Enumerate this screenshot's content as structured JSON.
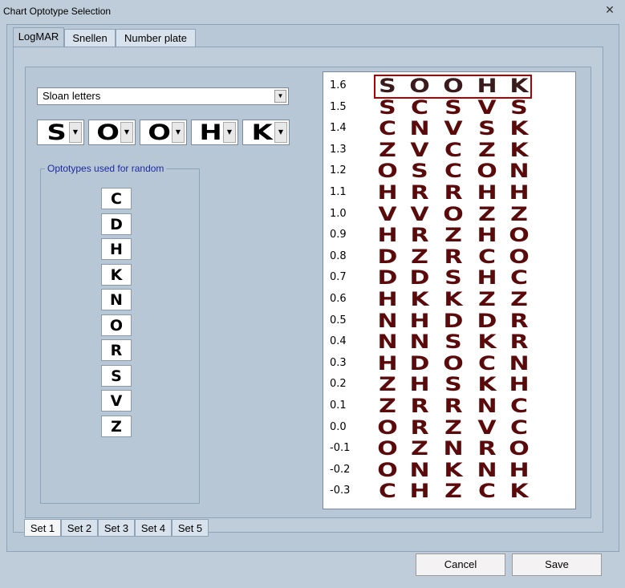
{
  "window": {
    "title": "Chart Optotype Selection",
    "close_symbol": "✕"
  },
  "tabs": [
    "LogMAR",
    "Snellen",
    "Number plate"
  ],
  "font_select": {
    "value": "Sloan letters"
  },
  "optotype_slots": [
    "S",
    "O",
    "O",
    "H",
    "K"
  ],
  "random_group": {
    "label": "Optotypes used for random",
    "letters": [
      "C",
      "D",
      "H",
      "K",
      "N",
      "O",
      "R",
      "S",
      "V",
      "Z"
    ]
  },
  "sets": [
    "Set 1",
    "Set 2",
    "Set 3",
    "Set 4",
    "Set 5"
  ],
  "chart_rows": [
    {
      "value": "1.6",
      "letters": [
        "S",
        "O",
        "O",
        "H",
        "K"
      ]
    },
    {
      "value": "1.5",
      "letters": [
        "S",
        "C",
        "S",
        "V",
        "S"
      ]
    },
    {
      "value": "1.4",
      "letters": [
        "C",
        "N",
        "V",
        "S",
        "K"
      ]
    },
    {
      "value": "1.3",
      "letters": [
        "Z",
        "V",
        "C",
        "Z",
        "K"
      ]
    },
    {
      "value": "1.2",
      "letters": [
        "O",
        "S",
        "C",
        "O",
        "N"
      ]
    },
    {
      "value": "1.1",
      "letters": [
        "H",
        "R",
        "R",
        "H",
        "H"
      ]
    },
    {
      "value": "1.0",
      "letters": [
        "V",
        "V",
        "O",
        "Z",
        "Z"
      ]
    },
    {
      "value": "0.9",
      "letters": [
        "H",
        "R",
        "Z",
        "H",
        "O"
      ]
    },
    {
      "value": "0.8",
      "letters": [
        "D",
        "Z",
        "R",
        "C",
        "O"
      ]
    },
    {
      "value": "0.7",
      "letters": [
        "D",
        "D",
        "S",
        "H",
        "C"
      ]
    },
    {
      "value": "0.6",
      "letters": [
        "H",
        "K",
        "K",
        "Z",
        "Z"
      ]
    },
    {
      "value": "0.5",
      "letters": [
        "N",
        "H",
        "D",
        "D",
        "R"
      ]
    },
    {
      "value": "0.4",
      "letters": [
        "N",
        "N",
        "S",
        "K",
        "R"
      ]
    },
    {
      "value": "0.3",
      "letters": [
        "H",
        "D",
        "O",
        "C",
        "N"
      ]
    },
    {
      "value": "0.2",
      "letters": [
        "Z",
        "H",
        "S",
        "K",
        "H"
      ]
    },
    {
      "value": "0.1",
      "letters": [
        "Z",
        "R",
        "R",
        "N",
        "C"
      ]
    },
    {
      "value": "0.0",
      "letters": [
        "O",
        "R",
        "Z",
        "V",
        "C"
      ]
    },
    {
      "value": "-0.1",
      "letters": [
        "O",
        "Z",
        "N",
        "R",
        "O"
      ]
    },
    {
      "value": "-0.2",
      "letters": [
        "O",
        "N",
        "K",
        "N",
        "H"
      ]
    },
    {
      "value": "-0.3",
      "letters": [
        "C",
        "H",
        "Z",
        "C",
        "K"
      ]
    }
  ],
  "buttons": {
    "cancel": "Cancel",
    "save": "Save"
  },
  "colors": {
    "chart_letter": "#5a0a0a",
    "highlight": "#b00000"
  }
}
